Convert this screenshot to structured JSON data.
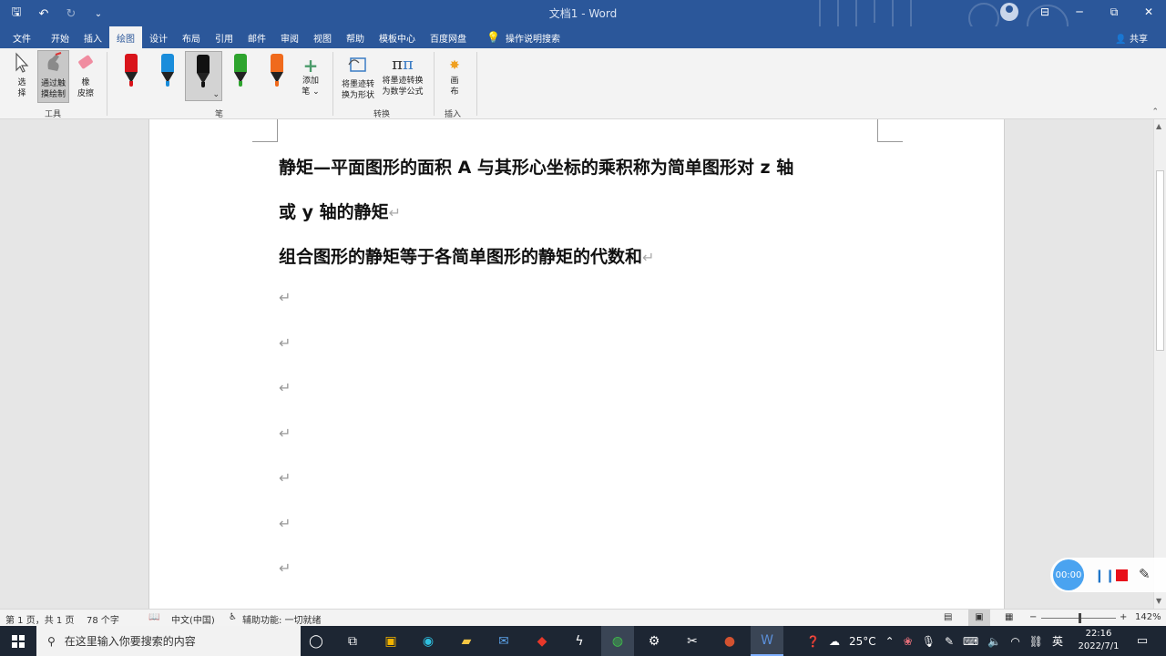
{
  "window": {
    "title": "文档1 - Word",
    "qat_save": "🖫",
    "qat_undo": "↶",
    "qat_redo": "↻",
    "qat_more": "⌄",
    "btn_ribbon": "⊟",
    "btn_min": "─",
    "btn_max": "⧉",
    "btn_close": "✕"
  },
  "tabs": [
    "文件",
    "开始",
    "插入",
    "绘图",
    "设计",
    "布局",
    "引用",
    "邮件",
    "审阅",
    "视图",
    "帮助",
    "模板中心",
    "百度网盘"
  ],
  "active_tab": "绘图",
  "tell_me": "操作说明搜索",
  "share": "共享",
  "ribbon": {
    "select_label": "选\n择",
    "touch_draw_label": "通过触\n摸绘制",
    "eraser_label": "橡\n皮擦",
    "tools_group": "工具",
    "add_pen_label": "添加\n笔 ⌄",
    "pens_group": "笔",
    "convert_shape_label": "将墨迹转\n换为形状",
    "convert_math_label": "将墨迹转换\n为数学公式",
    "convert_group": "转换",
    "canvas_label": "画\n布",
    "insert_group": "插入",
    "pen_colors": [
      "#d9141b",
      "#1a8ddb",
      "#111111",
      "#2ea42e",
      "#f06a1c"
    ]
  },
  "document": {
    "line1": "静矩—平面图形的面积 A 与其形心坐标的乘积称为简单图形对 z 轴",
    "line2": "或 y 轴的静矩",
    "line3": "组合图形的静矩等于各简单图形的静矩的代数和",
    "para_mark": "↵"
  },
  "recorder": {
    "time": "00:00"
  },
  "status": {
    "page": "第 1 页，共 1 页",
    "words": "78 个字",
    "lang": "中文(中国)",
    "accessibility": "辅助功能: 一切就绪",
    "zoom": "142%",
    "zoom_minus": "−",
    "zoom_plus": "+"
  },
  "taskbar": {
    "search_placeholder": "在这里输入你要搜索的内容",
    "temperature": "25°C",
    "ime": "英",
    "time": "22:16",
    "date": "2022/7/1"
  }
}
